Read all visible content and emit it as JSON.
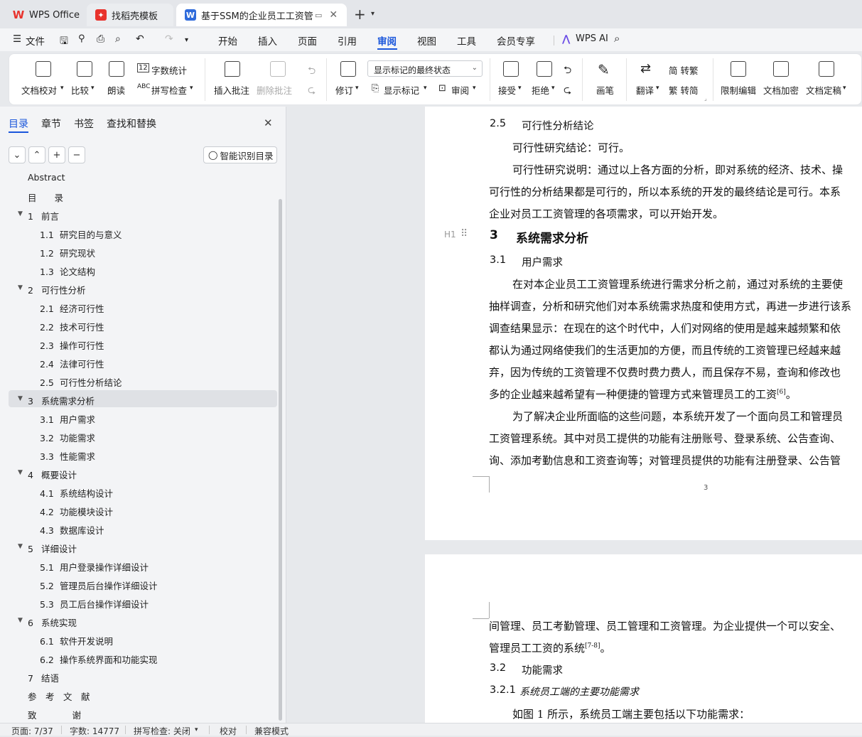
{
  "tabs": {
    "wps": "WPS Office",
    "template": "找稻壳模板",
    "doc": "基于SSM的企业员工工资管理",
    "new_tab": "+"
  },
  "menu": {
    "file": "文件",
    "items": [
      "开始",
      "插入",
      "页面",
      "引用",
      "审阅",
      "视图",
      "工具",
      "会员专享"
    ],
    "active": "审阅",
    "ai": "WPS AI"
  },
  "ribbon": {
    "proofread": "文档校对",
    "compare": "比较",
    "read_aloud": "朗读",
    "word_count": "字数统计",
    "spell_check": "拼写检查",
    "insert_comment": "插入批注",
    "delete_comment": "删除批注",
    "revise": "修订",
    "markup_state": "显示标记的最终状态",
    "show_markup": "显示标记",
    "review_pane": "审阅",
    "accept": "接受",
    "reject": "拒绝",
    "pen": "画笔",
    "translate": "翻译",
    "to_traditional": "简 转繁",
    "to_simplified": "繁 转简",
    "restrict_edit": "限制编辑",
    "encrypt": "文档加密",
    "finalize": "文档定稿"
  },
  "sidebar": {
    "tabs": [
      "目录",
      "章节",
      "书签",
      "查找和替换"
    ],
    "active_tab": "目录",
    "smart_toc": "智能识别目录",
    "toc": [
      {
        "num": "",
        "title": "Abstract",
        "level": 0
      },
      {
        "num": "",
        "title": "目　　录",
        "level": 0
      },
      {
        "num": "1",
        "title": "前言",
        "level": 0,
        "caret": true
      },
      {
        "num": "1.1",
        "title": "研究目的与意义",
        "level": 1
      },
      {
        "num": "1.2",
        "title": "研究现状",
        "level": 1
      },
      {
        "num": "1.3",
        "title": "论文结构",
        "level": 1
      },
      {
        "num": "2",
        "title": "可行性分析",
        "level": 0,
        "caret": true
      },
      {
        "num": "2.1",
        "title": "经济可行性",
        "level": 1
      },
      {
        "num": "2.2",
        "title": "技术可行性",
        "level": 1
      },
      {
        "num": "2.3",
        "title": "操作可行性",
        "level": 1
      },
      {
        "num": "2.4",
        "title": "法律可行性",
        "level": 1
      },
      {
        "num": "2.5",
        "title": "可行性分析结论",
        "level": 1
      },
      {
        "num": "3",
        "title": "系统需求分析",
        "level": 0,
        "caret": true,
        "selected": true
      },
      {
        "num": "3.1",
        "title": "用户需求",
        "level": 1
      },
      {
        "num": "3.2",
        "title": "功能需求",
        "level": 1
      },
      {
        "num": "3.3",
        "title": "性能需求",
        "level": 1
      },
      {
        "num": "4",
        "title": "概要设计",
        "level": 0,
        "caret": true
      },
      {
        "num": "4.1",
        "title": "系统结构设计",
        "level": 1
      },
      {
        "num": "4.2",
        "title": "功能模块设计",
        "level": 1
      },
      {
        "num": "4.3",
        "title": "数据库设计",
        "level": 1
      },
      {
        "num": "5",
        "title": "详细设计",
        "level": 0,
        "caret": true
      },
      {
        "num": "5.1",
        "title": "用户登录操作详细设计",
        "level": 1
      },
      {
        "num": "5.2",
        "title": "管理员后台操作详细设计",
        "level": 1
      },
      {
        "num": "5.3",
        "title": "员工后台操作详细设计",
        "level": 1
      },
      {
        "num": "6",
        "title": "系统实现",
        "level": 0,
        "caret": true
      },
      {
        "num": "6.1",
        "title": "软件开发说明",
        "level": 1
      },
      {
        "num": "6.2",
        "title": "操作系统界面和功能实现",
        "level": 1
      },
      {
        "num": "7",
        "title": "结语",
        "level": 0
      },
      {
        "num": "",
        "title": "参　考　文　献",
        "level": 0
      },
      {
        "num": "",
        "title": "致　　　　谢",
        "level": 0
      }
    ]
  },
  "document": {
    "page1": {
      "h_2_5_num": "2.5",
      "h_2_5": "可行性分析结论",
      "p1": "可行性研究结论：可行。",
      "p2a": "可行性研究说明：通过以上各方面的分析，即对系统的经济、技术、操",
      "p2b": "可行性的分析结果都是可行的，所以本系统的开发的最终结论是可行。本系",
      "p2c": "企业对员工工资管理的各项需求，可以开始开发。",
      "heading_marker": "H1",
      "h3_num": "3",
      "h3": "系统需求分析",
      "h_3_1_num": "3.1",
      "h_3_1": "用户需求",
      "p3a": "在对本企业员工工资管理系统进行需求分析之前，通过对系统的主要使",
      "p3b": "抽样调查，分析和研究他们对本系统需求热度和使用方式，再进一步进行该系",
      "p3c": "调查结果显示：在现在的这个时代中，人们对网络的使用是越来越频繁和依",
      "p3d": "都认为通过网络使我们的生活更加的方便，而且传统的工资管理已经越来越",
      "p3e": "弃，因为传统的工资管理不仅费时费力费人，而且保存不易，查询和修改也",
      "p3f": "多的企业越来越希望有一种便捷的管理方式来管理员工的工资",
      "p3f_ref": "[6]",
      "p3f_end": "。",
      "p4a": "为了解决企业所面临的这些问题，本系统开发了一个面向员工和管理员",
      "p4b": "工资管理系统。其中对员工提供的功能有注册账号、登录系统、公告查询、",
      "p4c": "询、添加考勤信息和工资查询等；对管理员提供的功能有注册登录、公告管",
      "page_number": "3"
    },
    "page2": {
      "p1a": "间管理、员工考勤管理、员工管理和工资管理。为企业提供一个可以安全、",
      "p1b": "管理员工工资的系统",
      "p1b_ref": "[7-8]",
      "p1b_end": "。",
      "h_3_2_num": "3.2",
      "h_3_2": "功能需求",
      "h_3_2_1_num": "3.2.1",
      "h_3_2_1": "系统员工端的主要功能需求",
      "p2": "如图 1 所示，系统员工端主要包括以下功能需求："
    }
  },
  "status": {
    "page": "页面: 7/37",
    "words": "字数: 14777",
    "spell": "拼写检查: 关闭",
    "proof": "校对",
    "compat": "兼容模式"
  },
  "colors": {
    "accent": "#1a56db",
    "wps_red": "#e8322c",
    "doc_blue": "#2f6bdb"
  }
}
